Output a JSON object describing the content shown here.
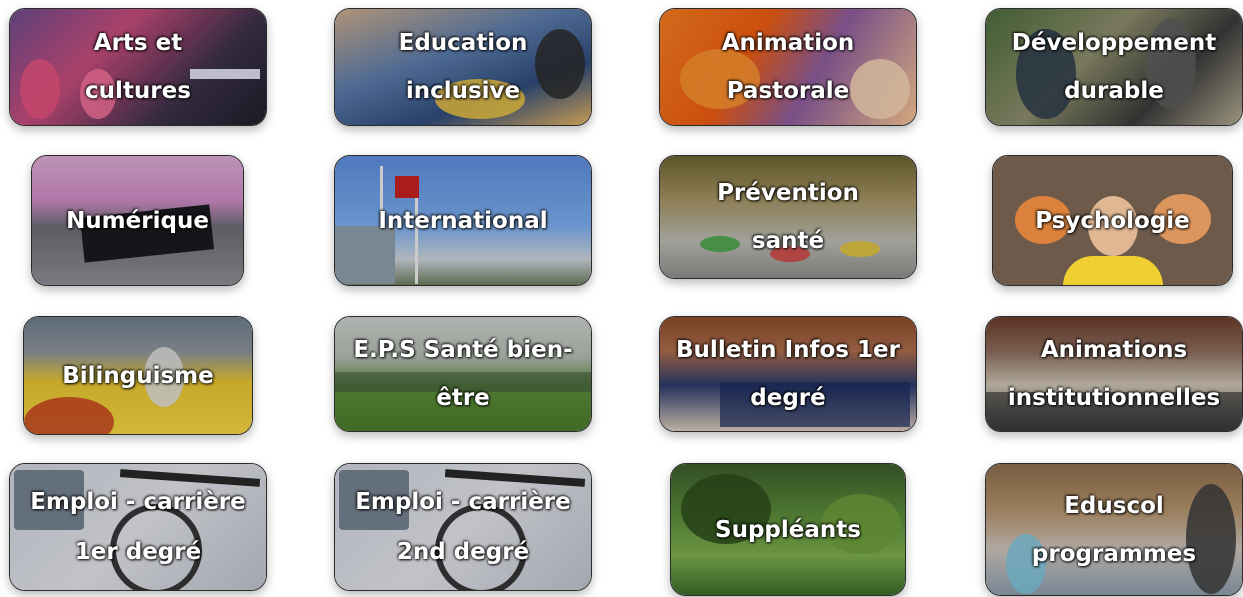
{
  "tiles": [
    {
      "label": "Arts et\ncultures"
    },
    {
      "label": "Education\ninclusive"
    },
    {
      "label": "Animation\nPastorale"
    },
    {
      "label": "Développement\ndurable"
    },
    {
      "label": "Numérique"
    },
    {
      "label": "International"
    },
    {
      "label": "Prévention\nsanté"
    },
    {
      "label": "Psychologie"
    },
    {
      "label": "Bilinguisme"
    },
    {
      "label": "E.P.S Santé bien-\nêtre"
    },
    {
      "label": "Bulletin Infos 1er\ndegré"
    },
    {
      "label": "Animations\ninstitutionnelles"
    },
    {
      "label": "Emploi - carrière\n1er degré"
    },
    {
      "label": "Emploi - carrière\n2nd degré"
    },
    {
      "label": "Suppléants"
    },
    {
      "label": "Eduscol\nprogrammes"
    }
  ]
}
